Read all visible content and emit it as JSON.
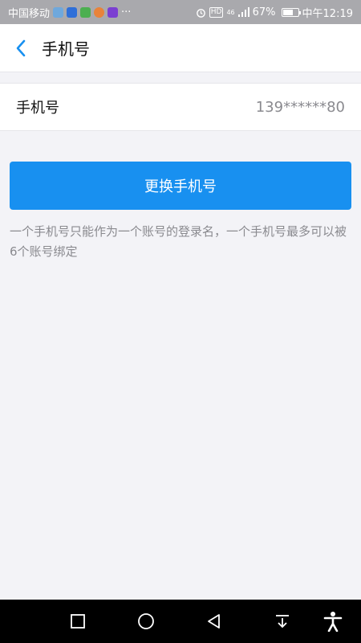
{
  "status_bar": {
    "carrier": "中国移动",
    "more": "···",
    "signal_label": "46",
    "battery": "67%",
    "time": "中午12:19"
  },
  "header": {
    "title": "手机号"
  },
  "phone_row": {
    "label": "手机号",
    "value": "139******80"
  },
  "primary_button": {
    "label": "更换手机号"
  },
  "hint": {
    "text": "一个手机号只能作为一个账号的登录名，一个手机号最多可以被6个账号绑定"
  },
  "colors": {
    "accent": "#1890f0",
    "status_bar": "#a9a9ad",
    "background": "#f3f3f7"
  },
  "icons": {
    "back": "chevron-left-icon",
    "nav_recent": "square-icon",
    "nav_home": "circle-icon",
    "nav_back": "triangle-left-icon",
    "nav_pull": "down-arrow-icon",
    "nav_accessibility": "accessibility-icon"
  }
}
